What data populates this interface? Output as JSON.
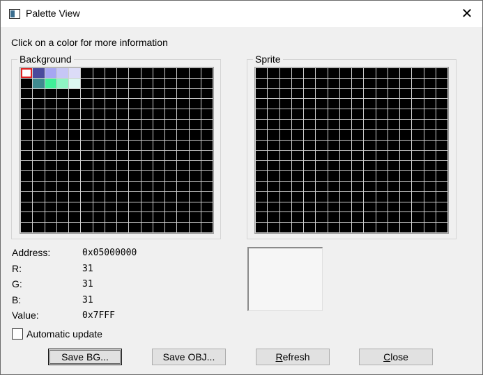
{
  "window": {
    "title": "Palette View",
    "close_glyph": "✕",
    "icon": "palette-window-icon"
  },
  "hint": "Click on a color for more information",
  "background_group": {
    "label": "Background",
    "selected_index": 0,
    "colors": [
      {
        "index": 0,
        "hex": "#ffffff"
      },
      {
        "index": 1,
        "hex": "#4a4a9c"
      },
      {
        "index": 2,
        "hex": "#a6a6f2"
      },
      {
        "index": 3,
        "hex": "#c6c6f6"
      },
      {
        "index": 4,
        "hex": "#dcdcf8"
      },
      {
        "index": 17,
        "hex": "#3f8a8f"
      },
      {
        "index": 18,
        "hex": "#3ff098"
      },
      {
        "index": 19,
        "hex": "#8ff4c4"
      },
      {
        "index": 20,
        "hex": "#dcf8f2"
      }
    ]
  },
  "sprite_group": {
    "label": "Sprite"
  },
  "info": {
    "address_label": "Address:",
    "address_value": "0x05000000",
    "r_label": "R:",
    "r_value": "31",
    "g_label": "G:",
    "g_value": "31",
    "b_label": "B:",
    "b_value": "31",
    "value_label": "Value:",
    "value_value": "0x7FFF"
  },
  "preview_color": "#f6f6f6",
  "auto_update": {
    "label": "Automatic update",
    "checked": false
  },
  "buttons": {
    "save_bg": "Save BG...",
    "save_obj": "Save OBJ...",
    "refresh_first": "R",
    "refresh_rest": "efresh",
    "close_first": "C",
    "close_rest": "lose"
  },
  "colors": {
    "selection_border": "#e02020",
    "grid_line": "#cfcfcf",
    "cell_empty": "#000000"
  }
}
